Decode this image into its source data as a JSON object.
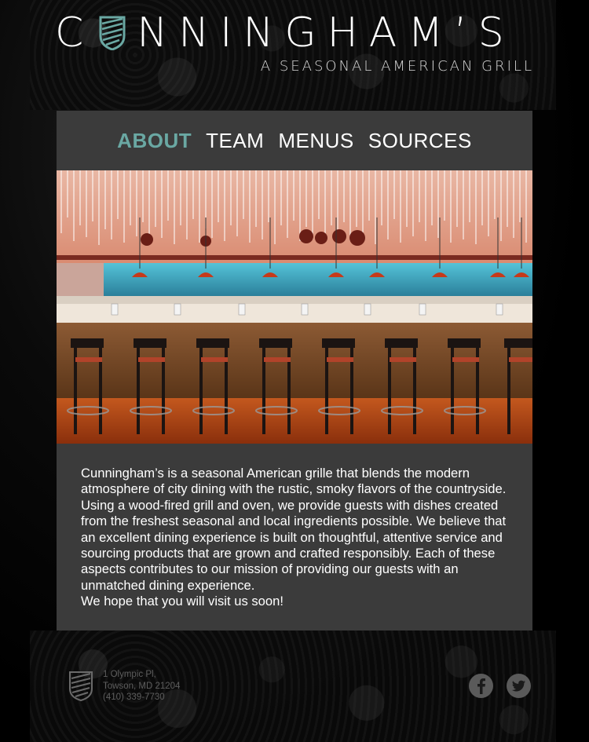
{
  "brand": {
    "name_left": "C",
    "name_right": "NNINGHAM’S",
    "tagline": "A SEASONAL AMERICAN GRILL",
    "accent_color": "#6aa8a3",
    "panel_color": "#3b3b3b"
  },
  "nav": {
    "items": [
      {
        "label": "ABOUT",
        "active": true
      },
      {
        "label": "TEAM",
        "active": false
      },
      {
        "label": "MENUS",
        "active": false
      },
      {
        "label": "SOURCES",
        "active": false
      }
    ]
  },
  "hero": {
    "icon": "restaurant-bar-photo"
  },
  "about": {
    "paragraph": "Cunningham’s is a seasonal American grille that blends the modern atmosphere of city dining with the rustic, smoky flavors of the countryside. Using a wood-fired grill and oven, we provide guests with dishes created from the freshest seasonal and local ingredients possible. We believe that an excellent dining experience is built on thoughtful, attentive service and sourcing products that are grown and crafted responsibly. Each of these aspects contributes to our mission of providing our guests with an unmatched dining experience.",
    "closing": "We hope that you will visit us soon!"
  },
  "footer": {
    "address_line1": "1 Olympic Pl,",
    "address_line2": "Towson, MD 21204",
    "phone": "(410) 339-7730",
    "social": [
      {
        "name": "facebook-icon",
        "glyph": "f"
      },
      {
        "name": "twitter-icon",
        "glyph": "t"
      }
    ]
  }
}
